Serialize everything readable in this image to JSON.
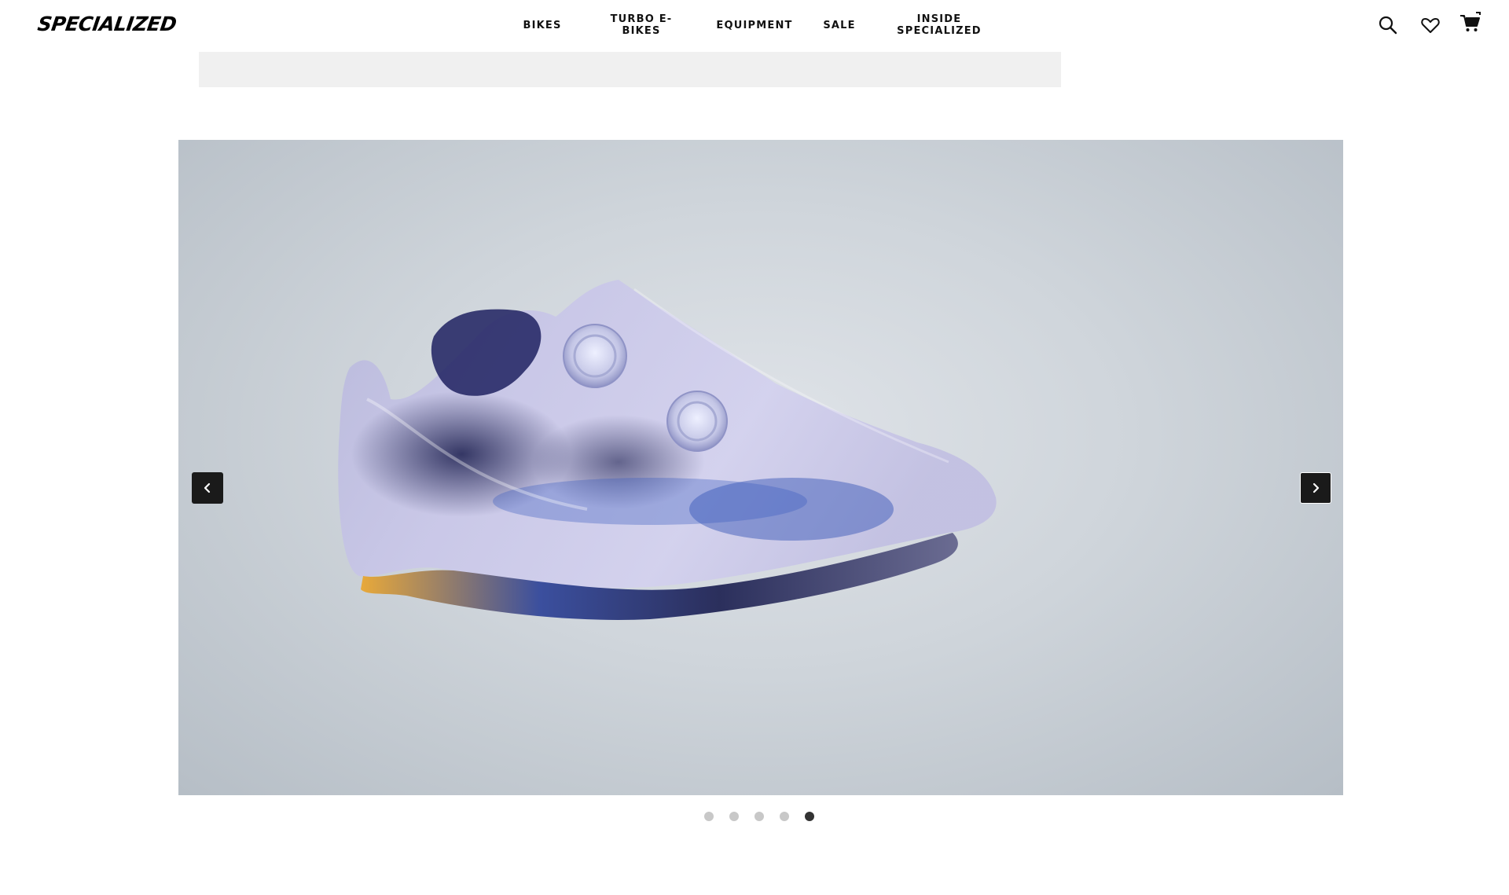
{
  "brand": {
    "logo_text": "SPECIALIZED"
  },
  "nav": {
    "items": [
      {
        "label": "BIKES"
      },
      {
        "label": "TURBO E-BIKES"
      },
      {
        "label": "EQUIPMENT"
      },
      {
        "label": "SALE"
      },
      {
        "label_line1": "INSIDE",
        "label_line2": "SPECIALIZED"
      }
    ]
  },
  "header_icons": [
    "search-icon",
    "heart-icon",
    "cart-icon"
  ],
  "carousel": {
    "slide_count": 5,
    "active_index": 4,
    "image_subject": "shoe-photo",
    "prev_icon": "chevron-left-icon",
    "next_icon": "chevron-right-icon"
  },
  "colors": {
    "arrow_bg": "#1a1a1a",
    "dot_inactive": "#c8c8c8",
    "dot_active": "#333333",
    "placeholder_bar": "#f0f0f0"
  }
}
